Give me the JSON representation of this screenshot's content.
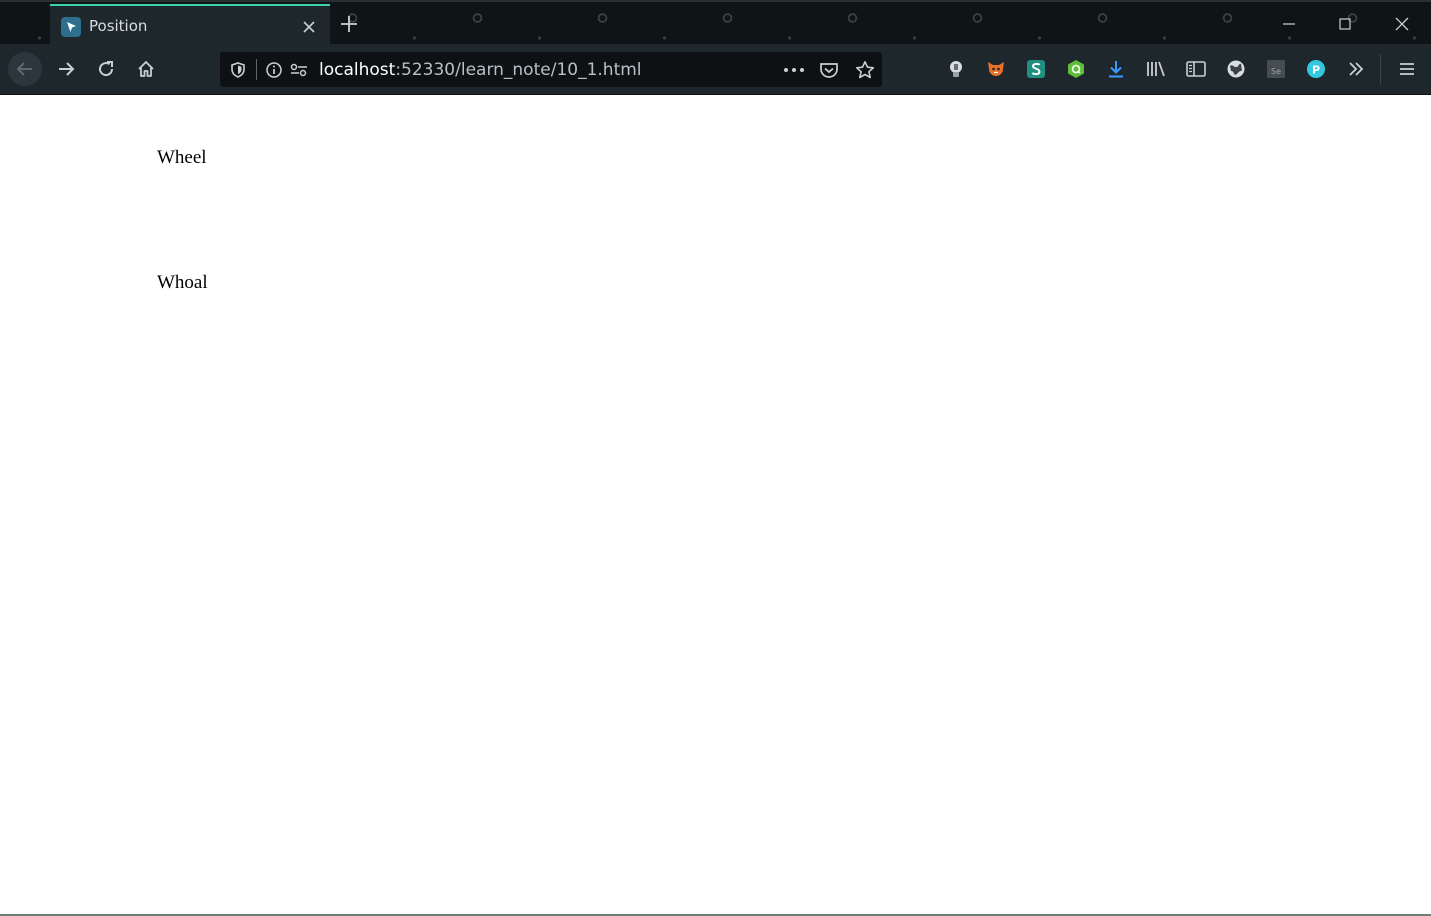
{
  "tab": {
    "title": "Position",
    "favicon": "cursor-arrow-icon"
  },
  "window_controls": [
    "minimize-icon",
    "maximize-icon",
    "close-icon"
  ],
  "navigation": {
    "buttons": [
      "back-arrow-icon",
      "forward-arrow-icon",
      "reload-icon",
      "home-icon"
    ]
  },
  "address_bar": {
    "url_host": "localhost",
    "url_rest": ":52330/learn_note/10_1.html",
    "left_icons": [
      "shield-icon",
      "info-icon",
      "permissions-icon"
    ],
    "right_icons": [
      "more-actions-icon",
      "pocket-icon",
      "bookmark-star-icon"
    ]
  },
  "toolbar_extensions": [
    "bulb-extension-icon",
    "fox-extension-icon",
    "s-extension-icon",
    "hexagon-extension-icon",
    "download-icon",
    "library-icon",
    "sidebar-icon",
    "globe-extension-icon",
    "selenium-extension-icon",
    "p-extension-icon",
    "overflow-chevrons-icon",
    "hamburger-menu-icon"
  ],
  "page": {
    "line1": "Wheel",
    "line2": "Whoal"
  },
  "colors": {
    "tab_accent": "#3ad3b0",
    "chrome_bg": "#1e272c",
    "url_bg": "#0d1114",
    "download_blue": "#3b9cff"
  }
}
